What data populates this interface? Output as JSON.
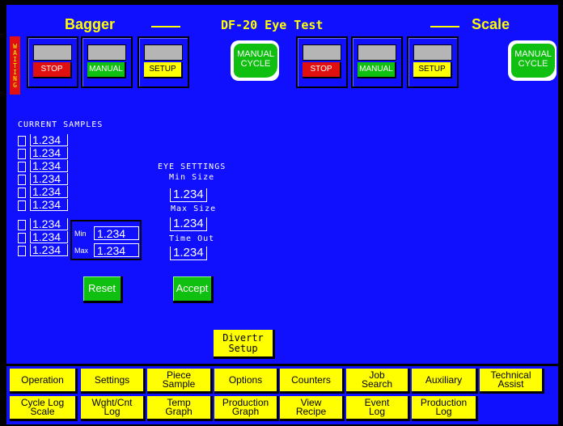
{
  "header": {
    "left_title": "Bagger",
    "center_title": "DF-20 Eye Test",
    "right_title": "Scale"
  },
  "status": {
    "waiting_label": "WAITING"
  },
  "bagger_controls": {
    "stop": "STOP",
    "manual": "MANUAL",
    "setup": "SETUP",
    "cycle_line1": "MANUAL",
    "cycle_line2": "CYCLE"
  },
  "scale_controls": {
    "stop": "STOP",
    "manual": "MANUAL",
    "setup": "SETUP",
    "cycle_line1": "MANUAL",
    "cycle_line2": "CYCLE"
  },
  "samples": {
    "label": "CURRENT SAMPLES",
    "values": [
      "1.234",
      "1.234",
      "1.234",
      "1.234",
      "1.234",
      "1.234",
      "1.234",
      "1.234",
      "1.234"
    ],
    "min_label": "Min",
    "min_value": "1.234",
    "max_label": "Max",
    "max_value": "1.234"
  },
  "eye_settings": {
    "title": "EYE SETTINGS",
    "min_size_label": "Min Size",
    "min_size_value": "1.234",
    "max_size_label": "Max Size",
    "max_size_value": "1.234",
    "timeout_label": "Time Out",
    "timeout_value": "1.234"
  },
  "actions": {
    "reset": "Reset",
    "accept": "Accept"
  },
  "divert": {
    "line1": "Divertr",
    "line2": "Setup"
  },
  "nav_row1": [
    {
      "l1": "Operation",
      "l2": ""
    },
    {
      "l1": "Settings",
      "l2": ""
    },
    {
      "l1": "Piece",
      "l2": "Sample"
    },
    {
      "l1": "Options",
      "l2": ""
    },
    {
      "l1": "Counters",
      "l2": ""
    },
    {
      "l1": "Job",
      "l2": "Search"
    },
    {
      "l1": "Auxiliary",
      "l2": ""
    },
    {
      "l1": "Technical",
      "l2": "Assist"
    }
  ],
  "nav_row2": [
    {
      "l1": "Cycle Log",
      "l2": "Scale"
    },
    {
      "l1": "Wght/Cnt",
      "l2": "Log"
    },
    {
      "l1": "Temp",
      "l2": "Graph"
    },
    {
      "l1": "Production",
      "l2": "Graph"
    },
    {
      "l1": "View",
      "l2": "Recipe"
    },
    {
      "l1": "Event",
      "l2": "Log"
    },
    {
      "l1": "Production",
      "l2": "Log"
    }
  ]
}
